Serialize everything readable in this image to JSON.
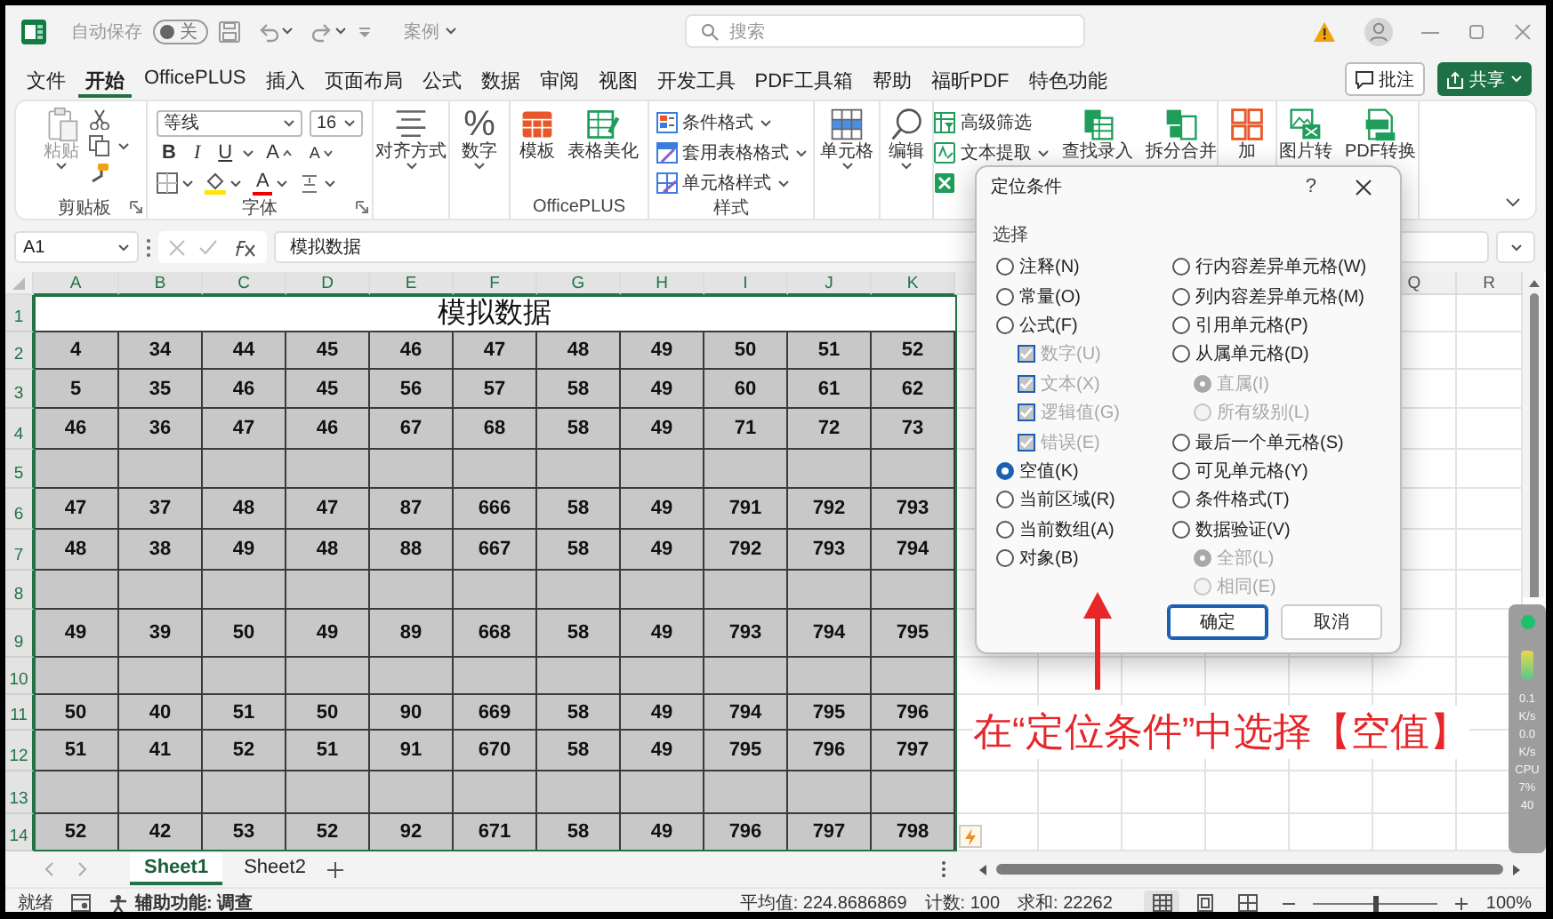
{
  "title_bar": {
    "autosave_label": "自动保存",
    "autosave": {
      "on": false,
      "label": "关"
    },
    "file_name": "案例",
    "search": {
      "placeholder": "搜索"
    }
  },
  "menu": {
    "tabs": [
      {
        "label": "文件",
        "selected": false
      },
      {
        "label": "开始",
        "selected": true
      },
      {
        "label": "OfficePLUS",
        "selected": false
      },
      {
        "label": "插入",
        "selected": false
      },
      {
        "label": "页面布局",
        "selected": false
      },
      {
        "label": "公式",
        "selected": false
      },
      {
        "label": "数据",
        "selected": false
      },
      {
        "label": "审阅",
        "selected": false
      },
      {
        "label": "视图",
        "selected": false
      },
      {
        "label": "开发工具",
        "selected": false
      },
      {
        "label": "PDF工具箱",
        "selected": false
      },
      {
        "label": "帮助",
        "selected": false
      },
      {
        "label": "福昕PDF",
        "selected": false
      },
      {
        "label": "特色功能",
        "selected": false
      }
    ],
    "comment_button": "批注",
    "share_button": "共享"
  },
  "ribbon": {
    "clipboard": {
      "label": "剪贴板",
      "paste": {
        "label": "粘贴",
        "disabled": true
      }
    },
    "font": {
      "label": "字体",
      "font_name": "等线",
      "font_size": "16",
      "bold": "B",
      "italic": "I",
      "underline": "U",
      "grow": "A",
      "shrink": "A",
      "font_color": "A"
    },
    "alignment": {
      "label": "对齐方式"
    },
    "number": {
      "symbol": "%",
      "label": "数字"
    },
    "officeplus": {
      "label": "OfficePLUS",
      "buttons": [
        "模板",
        "表格美化"
      ]
    },
    "styles": {
      "label": "样式",
      "buttons": [
        "条件格式",
        "套用表格格式",
        "单元格样式"
      ]
    },
    "cells": {
      "label": "单元格"
    },
    "editing": {
      "label": "编辑"
    },
    "tools": {
      "small_buttons": [
        {
          "label": "高级筛选",
          "dropdown": false
        },
        {
          "label": "文本提取",
          "dropdown": true
        },
        {
          "dropdown": false
        }
      ],
      "large_buttons": [
        "查找录入",
        "拆分合并"
      ]
    },
    "more": {
      "large_buttons": [
        "加",
        "图片转",
        "PDF转换"
      ]
    }
  },
  "formula_bar": {
    "name_box": "A1",
    "formula": "模拟数据"
  },
  "sheet": {
    "columns": [
      "A",
      "B",
      "C",
      "D",
      "E",
      "F",
      "G",
      "H",
      "I",
      "J",
      "K"
    ],
    "right_columns": [
      "Q",
      "R"
    ],
    "rows": [
      {
        "number": "1",
        "title": "模拟数据"
      },
      {
        "number": "2",
        "cells": [
          "4",
          "34",
          "44",
          "45",
          "46",
          "47",
          "48",
          "49",
          "50",
          "51",
          "52"
        ]
      },
      {
        "number": "3",
        "cells": [
          "5",
          "35",
          "46",
          "45",
          "56",
          "57",
          "58",
          "49",
          "60",
          "61",
          "62"
        ]
      },
      {
        "number": "4",
        "cells": [
          "46",
          "36",
          "47",
          "46",
          "67",
          "68",
          "58",
          "49",
          "71",
          "72",
          "73"
        ]
      },
      {
        "number": "5"
      },
      {
        "number": "6",
        "cells": [
          "47",
          "37",
          "48",
          "47",
          "87",
          "666",
          "58",
          "49",
          "791",
          "792",
          "793"
        ]
      },
      {
        "number": "7",
        "cells": [
          "48",
          "38",
          "49",
          "48",
          "88",
          "667",
          "58",
          "49",
          "792",
          "793",
          "794"
        ]
      },
      {
        "number": "8"
      },
      {
        "number": "9",
        "cells": [
          "49",
          "39",
          "50",
          "49",
          "89",
          "668",
          "58",
          "49",
          "793",
          "794",
          "795"
        ]
      },
      {
        "number": "10"
      },
      {
        "number": "11",
        "cells": [
          "50",
          "40",
          "51",
          "50",
          "90",
          "669",
          "58",
          "49",
          "794",
          "795",
          "796"
        ]
      },
      {
        "number": "12",
        "cells": [
          "51",
          "41",
          "52",
          "51",
          "91",
          "670",
          "58",
          "49",
          "795",
          "796",
          "797"
        ]
      },
      {
        "number": "13"
      },
      {
        "number": "14",
        "cells": [
          "52",
          "42",
          "53",
          "52",
          "92",
          "671",
          "58",
          "49",
          "796",
          "797",
          "798"
        ]
      }
    ]
  },
  "sheet_tabs": [
    {
      "label": "Sheet1",
      "selected": true
    },
    {
      "label": "Sheet2",
      "selected": false
    }
  ],
  "status_bar": {
    "ready": "就绪",
    "accessibility": "辅助功能: 调查",
    "average": "平均值: 224.8686869",
    "count": "计数: 100",
    "sum": "求和: 22262",
    "views": [
      {
        "selected": true
      },
      {
        "selected": false
      },
      {
        "selected": false
      }
    ],
    "zoom_slider": {
      "level": 0.5
    },
    "zoom": "100%"
  },
  "dialog": {
    "title": "定位条件",
    "help": "?",
    "section": "选择",
    "left": [
      {
        "kind": "radio",
        "label": "注释(N)",
        "selected": false,
        "disabled": false
      },
      {
        "kind": "radio",
        "label": "常量(O)",
        "selected": false,
        "disabled": false
      },
      {
        "kind": "radio",
        "label": "公式(F)",
        "selected": false,
        "disabled": false,
        "children": [
          {
            "kind": "checkbox",
            "label": "数字(U)",
            "checked": true,
            "disabled": true
          },
          {
            "kind": "checkbox",
            "label": "文本(X)",
            "checked": true,
            "disabled": true
          },
          {
            "kind": "checkbox",
            "label": "逻辑值(G)",
            "checked": true,
            "disabled": true
          },
          {
            "kind": "checkbox",
            "label": "错误(E)",
            "checked": true,
            "disabled": true
          }
        ]
      },
      {
        "kind": "radio",
        "label": "空值(K)",
        "selected": true,
        "disabled": false
      },
      {
        "kind": "radio",
        "label": "当前区域(R)",
        "selected": false,
        "disabled": false
      },
      {
        "kind": "radio",
        "label": "当前数组(A)",
        "selected": false,
        "disabled": false
      },
      {
        "kind": "radio",
        "label": "对象(B)",
        "selected": false,
        "disabled": false
      }
    ],
    "right": [
      {
        "kind": "radio",
        "label": "行内容差异单元格(W)",
        "selected": false,
        "disabled": false
      },
      {
        "kind": "radio",
        "label": "列内容差异单元格(M)",
        "selected": false,
        "disabled": false
      },
      {
        "kind": "radio",
        "label": "引用单元格(P)",
        "selected": false,
        "disabled": false
      },
      {
        "kind": "radio",
        "label": "从属单元格(D)",
        "selected": false,
        "disabled": false,
        "children": [
          {
            "kind": "radio",
            "label": "直属(I)",
            "selected": true,
            "disabled": true
          },
          {
            "kind": "radio",
            "label": "所有级别(L)",
            "selected": false,
            "disabled": true
          }
        ]
      },
      {
        "kind": "radio",
        "label": "最后一个单元格(S)",
        "selected": false,
        "disabled": false
      },
      {
        "kind": "radio",
        "label": "可见单元格(Y)",
        "selected": false,
        "disabled": false
      },
      {
        "kind": "radio",
        "label": "条件格式(T)",
        "selected": false,
        "disabled": false
      },
      {
        "kind": "radio",
        "label": "数据验证(V)",
        "selected": false,
        "disabled": false,
        "children": [
          {
            "kind": "radio",
            "label": "全部(L)",
            "selected": true,
            "disabled": true
          },
          {
            "kind": "radio",
            "label": "相同(E)",
            "selected": false,
            "disabled": true
          }
        ]
      }
    ],
    "buttons": [
      {
        "label": "确定",
        "default": true
      },
      {
        "label": "取消",
        "default": false
      }
    ]
  },
  "annotation": {
    "text": "在“定位条件”中选择【空值】"
  },
  "monitor": {
    "texts": [
      "0.1",
      "K/s",
      "0.0",
      "K/s",
      "CPU",
      "7%",
      "40"
    ]
  }
}
